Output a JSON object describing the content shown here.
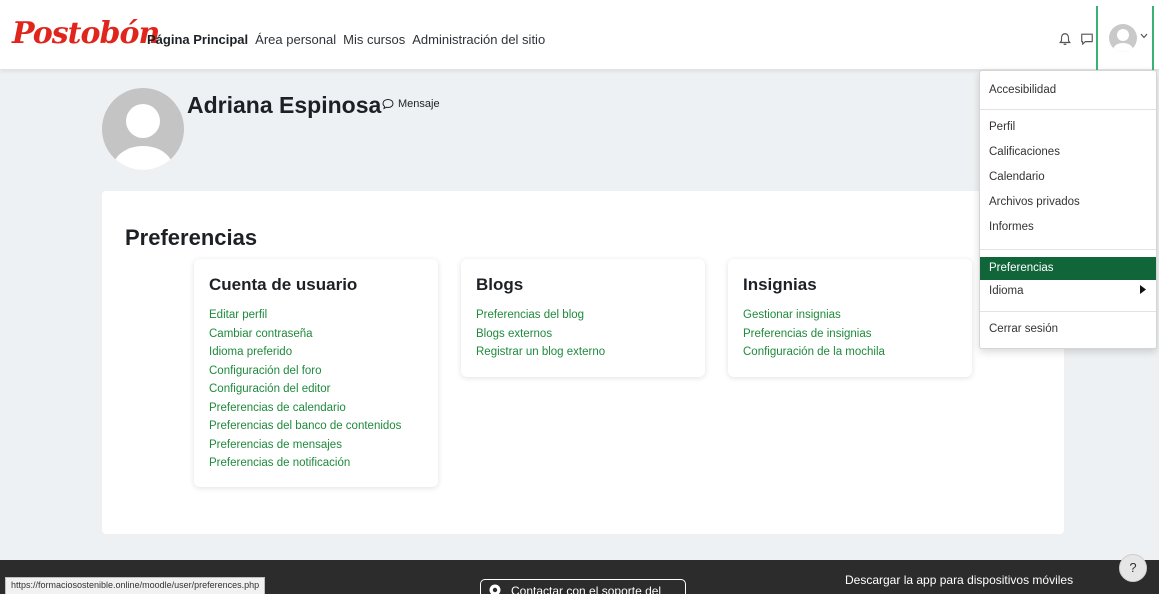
{
  "brand": {
    "logo_text": "Postobón"
  },
  "nav": {
    "items": [
      {
        "label": "Página Principal",
        "active": true
      },
      {
        "label": "Área personal",
        "active": false
      },
      {
        "label": "Mis cursos",
        "active": false
      },
      {
        "label": "Administración del sitio",
        "active": false
      }
    ],
    "icons": [
      "bell-icon",
      "chat-icon",
      "user-avatar",
      "chevron-down-icon"
    ]
  },
  "profile": {
    "name": "Adriana Espinosa",
    "message_label": "Mensaje"
  },
  "page": {
    "title": "Preferencias"
  },
  "sections": [
    {
      "title": "Cuenta de usuario",
      "links": [
        "Editar perfil",
        "Cambiar contraseña",
        "Idioma preferido",
        "Configuración del foro",
        "Configuración del editor",
        "Preferencias de calendario",
        "Preferencias del banco de contenidos",
        "Preferencias de mensajes",
        "Preferencias de notificación"
      ]
    },
    {
      "title": "Blogs",
      "links": [
        "Preferencias del blog",
        "Blogs externos",
        "Registrar un blog externo"
      ]
    },
    {
      "title": "Insignias",
      "links": [
        "Gestionar insignias",
        "Preferencias de insignias",
        "Configuración de la mochila"
      ]
    }
  ],
  "user_menu": {
    "items": [
      "Accesibilidad",
      "Perfil",
      "Calificaciones",
      "Calendario",
      "Archivos privados",
      "Informes",
      "Preferencias",
      "Idioma",
      "Cerrar sesión"
    ],
    "active": "Preferencias"
  },
  "footer": {
    "status_url": "https://formaciosostenible.online/moodle/user/preferences.php",
    "support_label": "Contactar con el soporte del sitio",
    "app_label": "Descargar la app para dispositivos móviles",
    "help_label": "?"
  },
  "colors": {
    "accent": "#1f8a3c",
    "active_bg": "#116639",
    "brand": "#e0261c",
    "footer_bg": "#2c2c2c"
  }
}
